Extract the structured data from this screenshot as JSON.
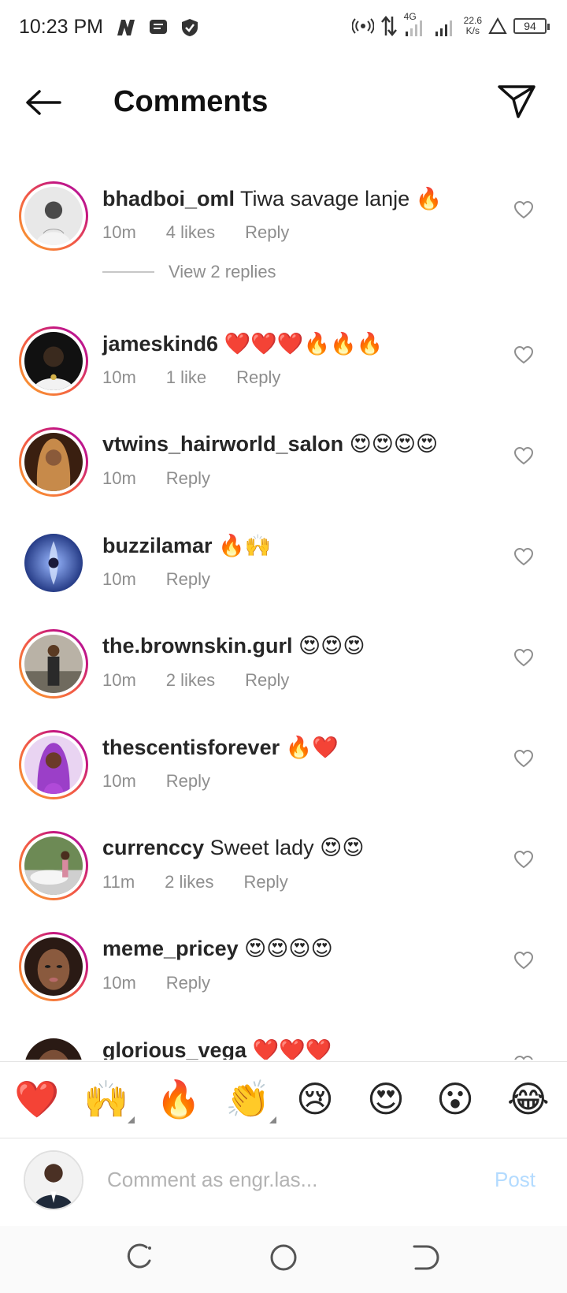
{
  "status_bar": {
    "time": "10:23 PM",
    "network": "4G",
    "speed_value": "22.6",
    "speed_unit": "K/s",
    "battery": "94",
    "left_icons": [
      "n-app-icon",
      "message-icon",
      "shield-icon"
    ],
    "right_icons": [
      "hotspot-icon",
      "data-transfer-icon",
      "signal-icon",
      "signal-icon",
      "alert-icon"
    ]
  },
  "header": {
    "title": "Comments"
  },
  "comments": [
    {
      "username": "bhadboi_oml",
      "text": "Tiwa savage lanje 🔥",
      "time": "10m",
      "likes": "4 likes",
      "reply": "Reply",
      "ring": true
    },
    {
      "username": "jameskind6",
      "text": "❤️❤️❤️🔥🔥🔥",
      "time": "10m",
      "likes": "1 like",
      "reply": "Reply",
      "ring": true
    },
    {
      "username": "vtwins_hairworld_salon",
      "text": "😍😍😍😍",
      "time": "10m",
      "likes": "",
      "reply": "Reply",
      "ring": true
    },
    {
      "username": "buzzilamar",
      "text": "🔥🙌",
      "time": "10m",
      "likes": "",
      "reply": "Reply",
      "ring": false
    },
    {
      "username": "the.brownskin.gurl",
      "text": "😍😍😍",
      "time": "10m",
      "likes": "2 likes",
      "reply": "Reply",
      "ring": true
    },
    {
      "username": "thescentisforever",
      "text": "🔥❤️",
      "time": "10m",
      "likes": "",
      "reply": "Reply",
      "ring": true
    },
    {
      "username": "currenccy",
      "text": "Sweet lady 😍😍",
      "time": "11m",
      "likes": "2 likes",
      "reply": "Reply",
      "ring": true
    },
    {
      "username": "meme_pricey",
      "text": "😍😍😍😍",
      "time": "10m",
      "likes": "",
      "reply": "Reply",
      "ring": true
    },
    {
      "username": "glorious_vega",
      "text": "❤️❤️❤️",
      "time": "",
      "likes": "",
      "reply": "",
      "ring": false
    }
  ],
  "view_replies": "View 2 replies",
  "emoji_bar": [
    "❤️",
    "🙌",
    "🔥",
    "👏",
    "😢",
    "😍",
    "😮",
    "😂"
  ],
  "comment_input": {
    "placeholder": "Comment as engr.las...",
    "post_label": "Post"
  },
  "colors": {
    "text": "#262626",
    "meta": "#8e8e8e",
    "post_disabled": "#b3dbff",
    "ring_start": "#f9a52c",
    "ring_end": "#c5177f"
  }
}
